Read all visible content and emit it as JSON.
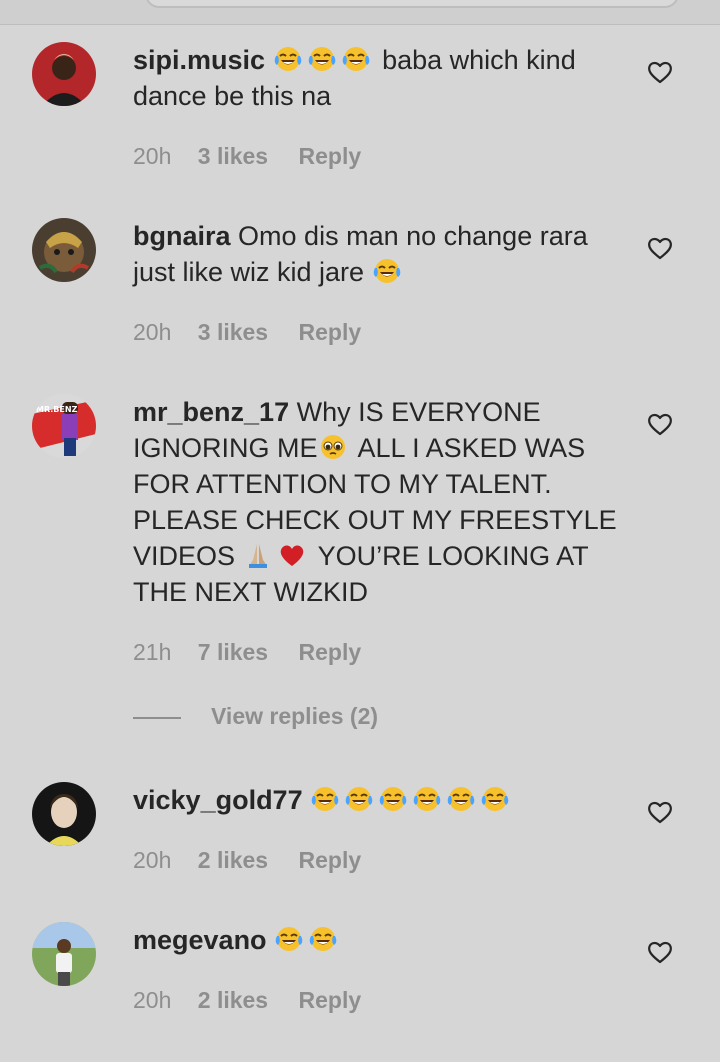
{
  "comments": [
    {
      "username": "sipi.music",
      "text_before_emoji": "",
      "emoji_count": 3,
      "emoji": "laughing-tears",
      "text": "baba which kind dance be this na",
      "time": "20h",
      "likes": "3 likes",
      "reply": "Reply"
    },
    {
      "username": "bgnaira",
      "text": "Omo dis man no change rara just like wiz kid jare",
      "emoji_count": 1,
      "emoji": "laughing-tears",
      "time": "20h",
      "likes": "3 likes",
      "reply": "Reply"
    },
    {
      "username": "mr_benz_17",
      "text_part1": "Why IS EVERYONE IGNORING ME",
      "text_part2": "ALL I ASKED WAS FOR ATTENTION TO MY TALENT. PLEASE CHECK OUT MY FREESTYLE VIDEOS",
      "text_part3": "YOU’RE LOOKING AT THE NEXT WIZKID",
      "emojis": [
        "pleading-face",
        "folded-hands",
        "red-heart"
      ],
      "time": "21h",
      "likes": "7 likes",
      "reply": "Reply",
      "view_replies": "View replies (2)"
    },
    {
      "username": "vicky_gold77",
      "emoji_count": 6,
      "emoji": "laughing-tears",
      "time": "20h",
      "likes": "2 likes",
      "reply": "Reply"
    },
    {
      "username": "megevano",
      "emoji_count": 2,
      "emoji": "laughing-tears",
      "time": "20h",
      "likes": "2 likes",
      "reply": "Reply"
    }
  ],
  "icons": {
    "like": "heart-outline-icon"
  },
  "colors": {
    "background": "#d6d6d6",
    "text": "#262626",
    "meta": "#8e8e8e"
  }
}
